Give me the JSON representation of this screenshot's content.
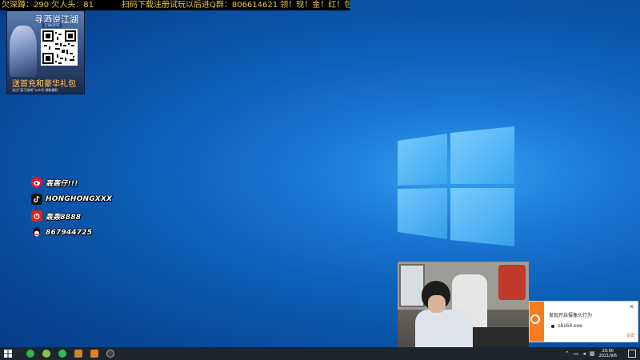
{
  "ticker": {
    "left": "欠深蹲：290 欠人头：81",
    "right": "扫码下载注册试玩以后进Q群：806614621 领！现！金！红！包！"
  },
  "ad_banner": {
    "title": "寻酒说江湖",
    "subtitle": "正版授权",
    "bottom_text": "送首充和豪华礼包",
    "fine_print": "关注“英子游戏”公众号 领取福利"
  },
  "socials": [
    {
      "icon": "weibo-icon",
      "color": "#e6162d",
      "label": "轰轰仔!!!"
    },
    {
      "icon": "tiktok-icon",
      "color": "#111111",
      "label": "HONGHONGXXX"
    },
    {
      "icon": "netease-music-icon",
      "color": "#d9241c",
      "label": "轰轰8888"
    },
    {
      "icon": "qq-icon",
      "color": "#1ebafc",
      "label": "867944725"
    }
  ],
  "notification": {
    "title": "发现开启摄像头行为",
    "process": "obs64.exe",
    "settings_label": "设置"
  },
  "taskbar": {
    "apps": [
      {
        "icon": "app-green-icon",
        "color": "#35b24a"
      },
      {
        "icon": "app-lime-icon",
        "color": "#8bc34a"
      },
      {
        "icon": "wechat-icon",
        "color": "#2fbf4f"
      },
      {
        "icon": "folder-icon",
        "color": "#c68a2b"
      },
      {
        "icon": "app-orange-icon",
        "color": "#e67e22"
      },
      {
        "icon": "obs-icon",
        "color": "#444444"
      }
    ],
    "clock_time": "20:00",
    "clock_date": "2021/9/6",
    "tray_icons": [
      "chevron-up-icon",
      "speaker-icon",
      "network-icon",
      "ime-icon"
    ]
  },
  "colors": {
    "desktop_accent": "#1a7ad6",
    "ticker_text": "#e8c84a",
    "taskbar_bg": "#1c2530",
    "notif_accent": "#f57c1f"
  }
}
